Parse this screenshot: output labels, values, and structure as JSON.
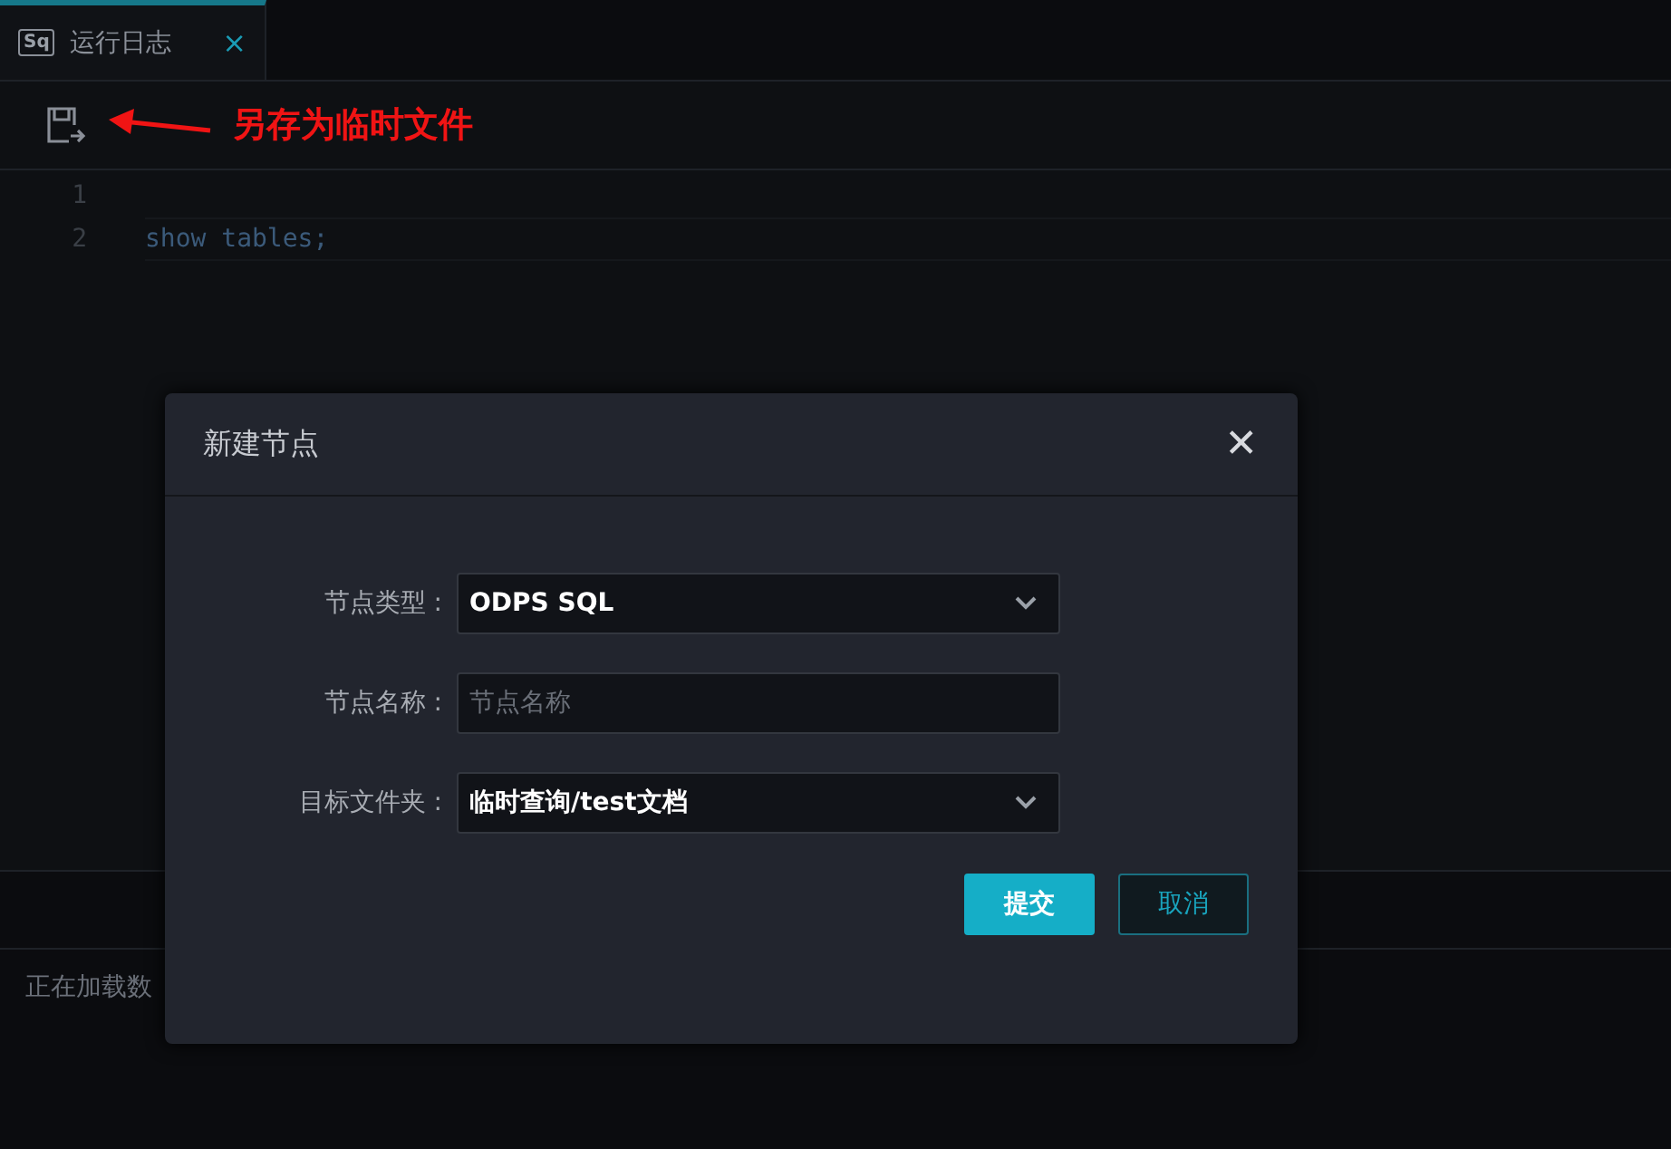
{
  "tabs": [
    {
      "icon_text": "Sq",
      "label": "运行日志",
      "selected": true,
      "close": "×"
    }
  ],
  "toolbar": {
    "annotation": "另存为临时文件"
  },
  "editor": {
    "lines": [
      {
        "number": "1"
      },
      {
        "number": "2",
        "code": "show tables;"
      }
    ]
  },
  "log": {
    "text": "正在加载数"
  },
  "dialog": {
    "title": "新建节点",
    "close": "✕",
    "fields": [
      {
        "kind": "select",
        "label": "节点类型 :",
        "value": "ODPS SQL"
      },
      {
        "kind": "input",
        "label": "节点名称 :",
        "placeholder": "节点名称"
      },
      {
        "kind": "select",
        "label": "目标文件夹 :",
        "value": "临时查询/test文档"
      }
    ],
    "buttons": [
      {
        "kind": "primary",
        "label": "提交"
      },
      {
        "kind": "secondary",
        "label": "取消"
      }
    ]
  }
}
